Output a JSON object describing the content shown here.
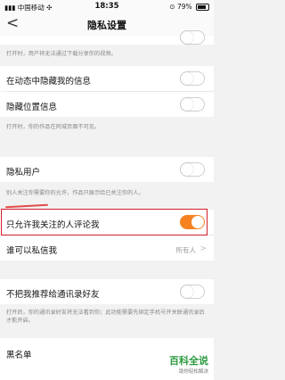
{
  "statusbar": {
    "carrier": "中国移动",
    "wifi": "✣",
    "time": "18:35",
    "lock": "⊙",
    "battery": "79%"
  },
  "nav": {
    "back": "<",
    "title": "隐私设置"
  },
  "rows": {
    "r0": {
      "hint": "打开时，用户将无法通过下载分享你的视频。",
      "on": false
    },
    "r1": {
      "label": "在动态中隐藏我的信息",
      "on": false
    },
    "r2": {
      "label": "隐藏位置信息",
      "on": false,
      "hint": "打开时，你的作品在同城页面不可见。"
    },
    "r3": {
      "label": "隐私用户",
      "on": false,
      "hint": "别人关注你需要你的允许，作品只展示给已关注你的人。"
    },
    "r4": {
      "label": "只允许我关注的人评论我",
      "on": true
    },
    "r5": {
      "label": "谁可以私信我",
      "value": "所有人",
      "chev": ">"
    },
    "r6": {
      "label": "不把我推荐给通讯录好友",
      "on": false,
      "hint": "打开后，你的通讯录好友将无法看到你；此功能需要先绑定手机号开关联通讯录后才能开启。"
    },
    "r7": {
      "label": "黑名单"
    }
  },
  "watermark": {
    "title": "百科全说",
    "subtitle": "助你轻松解决"
  },
  "colors": {
    "accent": "#f78221",
    "highlight": "#d21e2b"
  },
  "battery_level": 0.79
}
